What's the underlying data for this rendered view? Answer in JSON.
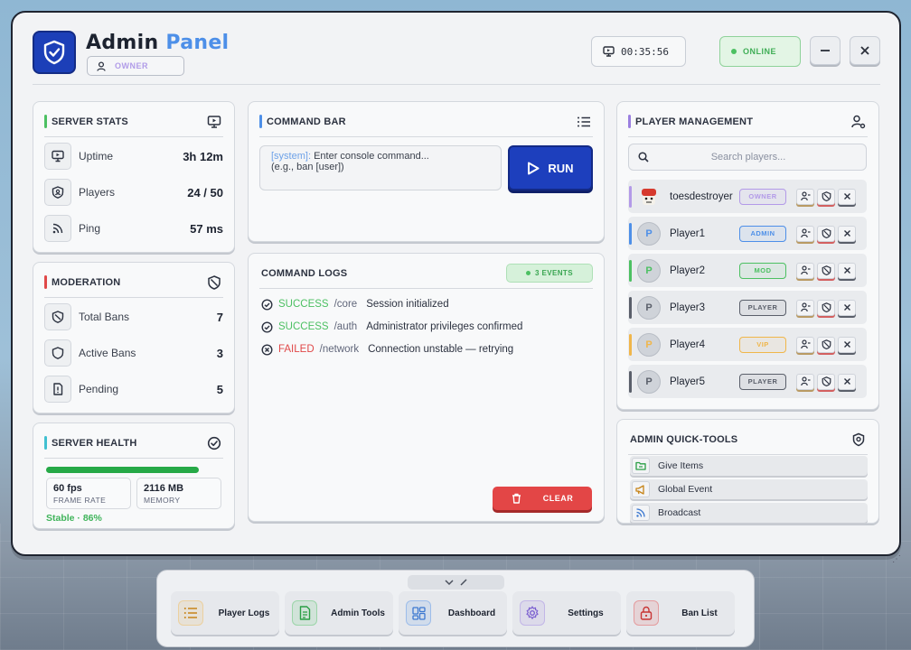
{
  "header": {
    "title_main": "Admin",
    "title_accent": "Panel",
    "role": "OWNER",
    "timer": "00:35:56",
    "status": "ONLINE"
  },
  "server_stats": {
    "title": "SERVER STATS",
    "rows": [
      {
        "label": "Uptime",
        "value": "3h 12m",
        "icon": "monitor-icon"
      },
      {
        "label": "Players",
        "value": "24 / 50",
        "icon": "shield-icon"
      },
      {
        "label": "Ping",
        "value": "57 ms",
        "icon": "rss-icon"
      }
    ]
  },
  "moderation": {
    "title": "MODERATION",
    "rows": [
      {
        "label": "Total Bans",
        "value": "7",
        "icon": "ban-icon"
      },
      {
        "label": "Active Bans",
        "value": "3",
        "icon": "shield-icon"
      },
      {
        "label": "Pending",
        "value": "5",
        "icon": "alert-file-icon"
      }
    ]
  },
  "server_health": {
    "title": "SERVER HEALTH",
    "health_fraction": 0.86,
    "fps_value": "60 fps",
    "fps_label": "FRAME RATE",
    "memory_value": "2116 MB",
    "memory_label": "MEMORY",
    "status": "Stable · 86%"
  },
  "command_bar": {
    "title": "COMMAND BAR",
    "system_tag": "[system]:",
    "input_text": "Enter console command...",
    "input_hint": "(e.g., ban [user])",
    "run_label": "RUN"
  },
  "command_logs": {
    "title": "COMMAND LOGS",
    "events_badge": "3 EVENTS",
    "entries": [
      {
        "status": "SUCCESS",
        "source": "/core",
        "message": "Session initialized"
      },
      {
        "status": "SUCCESS",
        "source": "/auth",
        "message": "Administrator privileges confirmed"
      },
      {
        "status": "FAILED",
        "source": "/network",
        "message": "Connection unstable — retrying"
      }
    ],
    "clear_label": "CLEAR"
  },
  "player_management": {
    "title": "PLAYER MANAGEMENT",
    "search_placeholder": "Search players...",
    "players": [
      {
        "name": "toesdestroyer",
        "role": "OWNER",
        "initial": "",
        "bar": "#b39ae8",
        "role_color": "#b39ae8"
      },
      {
        "name": "Player1",
        "role": "ADMIN",
        "initial": "P",
        "bar": "#4d8fe8",
        "role_color": "#4d8fe8"
      },
      {
        "name": "Player2",
        "role": "MOD",
        "initial": "P",
        "bar": "#4cc062",
        "role_color": "#4cc062"
      },
      {
        "name": "Player3",
        "role": "PLAYER",
        "initial": "P",
        "bar": "#5a5f6a",
        "role_color": "#5a5f6a"
      },
      {
        "name": "Player4",
        "role": "VIP",
        "initial": "P",
        "bar": "#f0b64a",
        "role_color": "#f0b64a"
      },
      {
        "name": "Player5",
        "role": "PLAYER",
        "initial": "P",
        "bar": "#5a5f6a",
        "role_color": "#5a5f6a"
      }
    ]
  },
  "quick_tools": {
    "title": "ADMIN QUICK-TOOLS",
    "tools": [
      {
        "label": "Give Items",
        "icon": "folder-icon",
        "color": "#4cc062"
      },
      {
        "label": "Global Event",
        "icon": "megaphone-icon",
        "color": "#e0a030"
      },
      {
        "label": "Broadcast",
        "icon": "rss-icon",
        "color": "#4d8fe8"
      }
    ]
  },
  "dock": {
    "items": [
      {
        "label": "Player Logs",
        "icon": "list-icon",
        "color": "#f0b64a"
      },
      {
        "label": "Admin Tools",
        "icon": "document-icon",
        "color": "#4cc062"
      },
      {
        "label": "Dashboard",
        "icon": "grid-icon",
        "color": "#4d8fe8"
      },
      {
        "label": "Settings",
        "icon": "gear-icon",
        "color": "#9b7fe0"
      },
      {
        "label": "Ban List",
        "icon": "lock-icon",
        "color": "#e04848"
      }
    ]
  }
}
